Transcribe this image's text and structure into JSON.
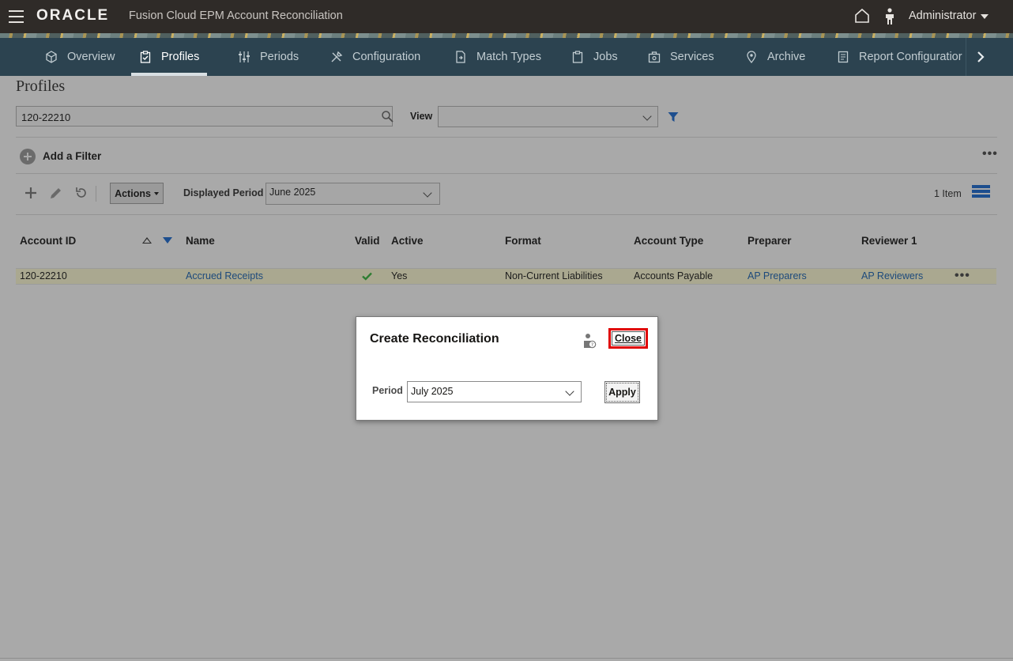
{
  "header": {
    "logo": "ORACLE",
    "app_title": "Fusion Cloud EPM Account Reconciliation",
    "user": "Administrator"
  },
  "nav": {
    "items": [
      {
        "label": "Overview",
        "icon": "cube-icon"
      },
      {
        "label": "Profiles",
        "icon": "clipboard-check-icon",
        "active": true
      },
      {
        "label": "Periods",
        "icon": "sliders-icon"
      },
      {
        "label": "Configuration",
        "icon": "tools-icon"
      },
      {
        "label": "Match Types",
        "icon": "match-doc-icon"
      },
      {
        "label": "Jobs",
        "icon": "clipboard-icon"
      },
      {
        "label": "Services",
        "icon": "toolbox-icon"
      },
      {
        "label": "Archive",
        "icon": "location-pin-icon"
      },
      {
        "label": "Report Configuratior",
        "icon": "report-icon"
      }
    ]
  },
  "page": {
    "title": "Profiles",
    "search_value": "120-22210",
    "view_label": "View",
    "view_value": "",
    "add_filter": "Add a Filter",
    "actions_label": "Actions",
    "displayed_period_label": "Displayed Period",
    "displayed_period_value": "June 2025",
    "item_count": "1 Item"
  },
  "table": {
    "headers": {
      "account_id": "Account ID",
      "name": "Name",
      "valid": "Valid",
      "active": "Active",
      "format": "Format",
      "account_type": "Account Type",
      "preparer": "Preparer",
      "reviewer": "Reviewer 1"
    },
    "rows": [
      {
        "account_id": "120-22210",
        "name": "Accrued Receipts",
        "valid": true,
        "active": "Yes",
        "format": "Non-Current Liabilities",
        "account_type": "Accounts Payable",
        "preparer": "AP Preparers",
        "reviewer": "AP Reviewers"
      }
    ]
  },
  "dialog": {
    "title": "Create Reconciliation",
    "close_label": "Close",
    "period_label": "Period",
    "period_value": "July 2025",
    "apply_label": "Apply"
  },
  "colors": {
    "header_bg": "#2f2b28",
    "nav_bg": "#2c4350",
    "overlay_bg": "#a9a9a9",
    "link": "#1d4a7c",
    "highlight": "#e00000",
    "accent": "#1d4e8e"
  }
}
